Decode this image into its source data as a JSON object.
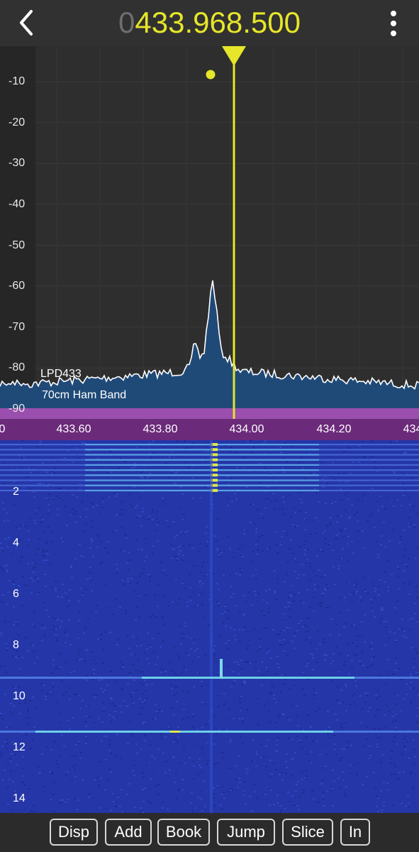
{
  "header": {
    "back_icon": "chevron-left-icon",
    "frequency_lead": "0",
    "frequency": "433.968.500",
    "menu_icon": "more-vertical-icon",
    "frequency_color": "#e6e62a"
  },
  "spectrum": {
    "db_labels": [
      "-10",
      "-20",
      "-30",
      "-40",
      "-50",
      "-60",
      "-70",
      "-80",
      "-90"
    ],
    "band_labels": [
      "LPD433",
      "70cm Ham Band"
    ],
    "trace_color": "#ffffff",
    "fill_color": "#1f4a78",
    "cursor_color": "#e6e62a",
    "band_color": "#9a4fae"
  },
  "axis": {
    "freq_labels": [
      "0",
      "433.60",
      "433.80",
      "434.00",
      "434.20",
      "434"
    ]
  },
  "waterfall": {
    "time_labels": [
      "2",
      "4",
      "6",
      "8",
      "10",
      "12",
      "14"
    ],
    "background_color": "#2536a8"
  },
  "toolbar": {
    "buttons": [
      "Disp",
      "Add",
      "Book",
      "Jump",
      "Slice",
      "In"
    ]
  }
}
